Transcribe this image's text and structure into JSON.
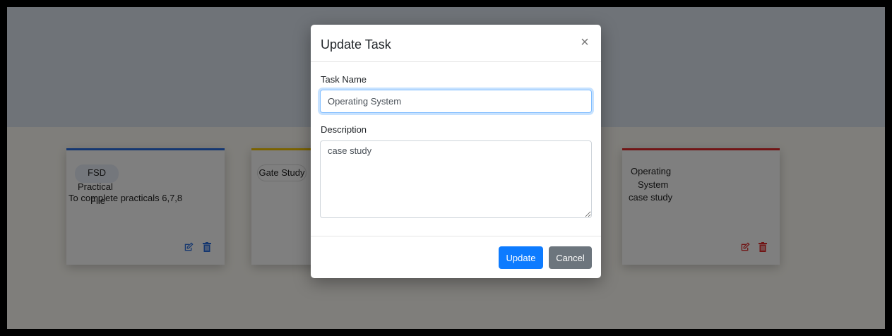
{
  "modal": {
    "title": "Update Task",
    "close_glyph": "×",
    "task_name_label": "Task Name",
    "task_name_value": "Operating System",
    "description_label": "Description",
    "description_value": "case study",
    "update_label": "Update",
    "cancel_label": "Cancel"
  },
  "cards": [
    {
      "title_lines": [
        "FSD",
        "Practical",
        "File"
      ],
      "description": "To complete practicals 6,7,8",
      "accent": "#2a6fe0",
      "icon_color": "#2a6fe0"
    },
    {
      "title": "Gate Study",
      "accent": "#f4c400"
    },
    {
      "title_lines": [
        "Operating",
        "System"
      ],
      "description": "case study",
      "accent": "#e22a2a",
      "icon_color": "#e22a2a"
    }
  ],
  "icons": {
    "edit": "edit-icon",
    "delete": "trash-icon"
  }
}
